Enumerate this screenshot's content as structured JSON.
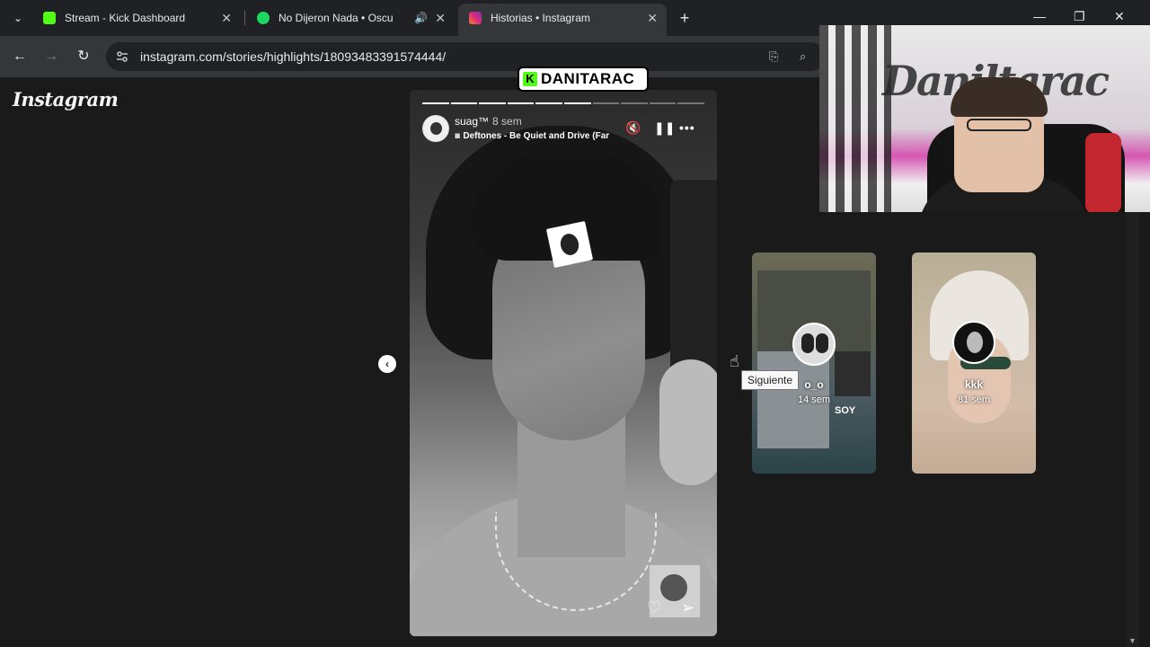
{
  "browser": {
    "tabs": [
      {
        "title": "Stream - Kick Dashboard",
        "favicon_color": "#53fc18"
      },
      {
        "title": "No Dijeron Nada • Oscu",
        "favicon_color": "#1ed760"
      },
      {
        "title": "Historias • Instagram",
        "favicon_color": "#e1306c"
      }
    ],
    "new_tab": "+",
    "url": "instagram.com/stories/highlights/18093483391574444/",
    "window": {
      "minimize": "—",
      "restore": "❐",
      "close": "✕"
    }
  },
  "page": {
    "logo": "Instagram",
    "story": {
      "username": "suag™",
      "time": "8 sem",
      "music": "Deftones - Be Quiet and Drive (Far",
      "progress_total": 10,
      "progress_done": 6
    },
    "tooltip": "Siguiente",
    "side_stories": [
      {
        "name": "o_o",
        "time": "14 sem",
        "extra": "SOY"
      },
      {
        "name": "kkk",
        "time": "81 sem"
      }
    ]
  },
  "overlay": {
    "brand_icon": "K",
    "brand_name": "DANITARAC",
    "webcam_graffiti": "Daniltarac"
  }
}
